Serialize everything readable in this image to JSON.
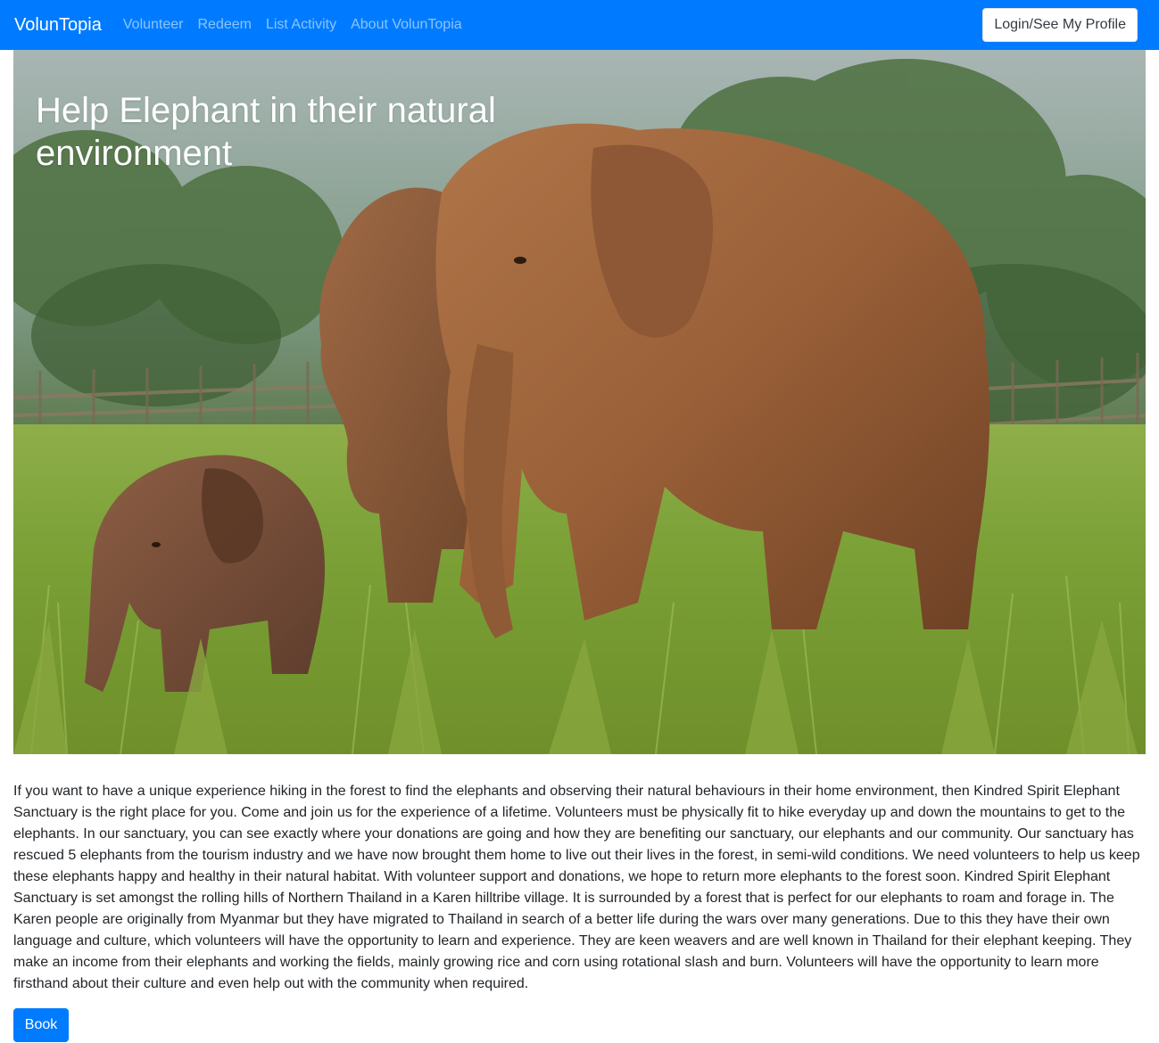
{
  "navbar": {
    "brand": "VolunTopia",
    "links": [
      "Volunteer",
      "Redeem",
      "List Activity",
      "About VolunTopia"
    ],
    "login_label": "Login/See My Profile",
    "bg_color": "#007bff"
  },
  "hero": {
    "title": "Help Elephant in their natural environment",
    "image_description_icon": "elephants-photo"
  },
  "description": "If you want to have a unique experience hiking in the forest to find the elephants and observing their natural behaviours in their home environment, then Kindred Spirit Elephant Sanctuary is the right place for you. Come and join us for the experience of a lifetime. Volunteers must be physically fit to hike everyday up and down the mountains to get to the elephants. In our sanctuary, you can see exactly where your donations are going and how they are benefiting our sanctuary, our elephants and our community. Our sanctuary has rescued 5 elephants from the tourism industry and we have now brought them home to live out their lives in the forest, in semi-wild conditions. We need volunteers to help us keep these elephants happy and healthy in their natural habitat. With volunteer support and donations, we hope to return more elephants to the forest soon. Kindred Spirit Elephant Sanctuary is set amongst the rolling hills of Northern Thailand in a Karen hilltribe village. It is surrounded by a forest that is perfect for our elephants to roam and forage in. The Karen people are originally from Myanmar but they have migrated to Thailand in search of a better life during the wars over many generations. Due to this they have their own language and culture, which volunteers will have the opportunity to learn and experience. They are keen weavers and are well known in Thailand for their elephant keeping. They make an income from their elephants and working the fields, mainly growing rice and corn using rotational slash and burn. Volunteers will have the opportunity to learn more firsthand about their culture and even help out with the community when required.",
  "book_label": "Book"
}
